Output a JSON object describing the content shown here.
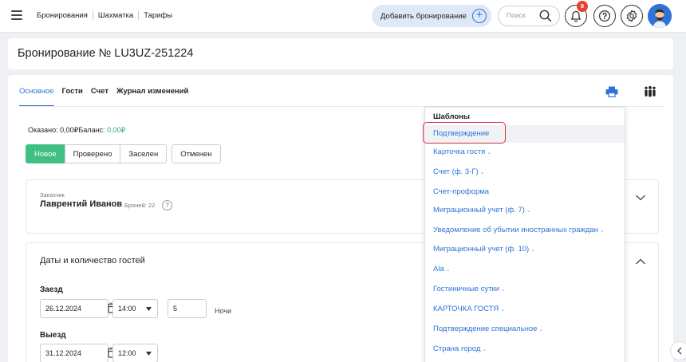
{
  "topbar": {
    "nav": [
      "Бронирования",
      "Шахматка",
      "Тарифы"
    ],
    "add_booking": "Добавить бронирование",
    "search_placeholder": "Поиск",
    "notifications_count": "8"
  },
  "page": {
    "title": "Бронирование № LU3UZ-251224"
  },
  "tabs": [
    "Основное",
    "Гости",
    "Счет",
    "Журнал изменений"
  ],
  "balance": {
    "paid_label": "Оказано: 0,00₽",
    "balance_label": "Баланс:",
    "balance_value": "0,00₽"
  },
  "statuses": [
    "Новое",
    "Проверено",
    "Заселен",
    "Отменен"
  ],
  "customer": {
    "label": "Заказчик",
    "name": "Лаврентий Иванов",
    "bookings": "Броней: 22",
    "help": "?"
  },
  "dates": {
    "heading": "Даты и количество гостей",
    "checkin_label": "Заезд",
    "checkin_date": "26.12.2024",
    "checkin_time": "14:00",
    "nights_value": "5",
    "nights_label": "Ночи",
    "checkout_label": "Выезд",
    "checkout_date": "31.12.2024",
    "checkout_time": "12:00"
  },
  "templates": {
    "title": "Шаблоны",
    "items": [
      {
        "label": "Подтверждение"
      },
      {
        "label": "Карточка гостя"
      },
      {
        "label": "Счет (ф. 3-Г)"
      },
      {
        "label": "Счет-проформа"
      },
      {
        "label": "Миграционный учет (ф. 7)"
      },
      {
        "label": "Уведомление об убытии иностранных граждан"
      },
      {
        "label": "Миграционный учет (ф. 10)"
      },
      {
        "label": "Ala"
      },
      {
        "label": "Гостиничные сутки"
      },
      {
        "label": "КАРТОЧКА ГОСТЯ"
      },
      {
        "label": "Подтверждение специальное"
      },
      {
        "label": "Страна город"
      }
    ]
  },
  "colors": {
    "accent": "#2f73d8",
    "status_active": "#3fbf84",
    "badge": "#e5432f",
    "highlight": "#d9303a"
  }
}
